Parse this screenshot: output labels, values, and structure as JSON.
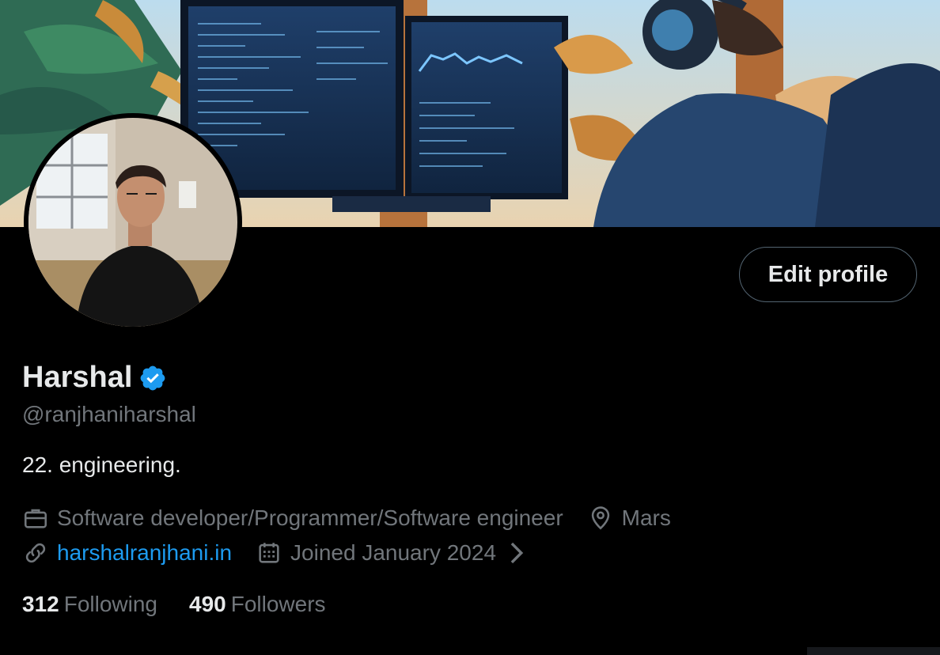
{
  "profile": {
    "name": "Harshal",
    "handle": "@ranjhaniharshal",
    "bio": "22. engineering.",
    "profession": "Software developer/Programmer/Software engineer",
    "location": "Mars",
    "website": "harshalranjhani.in",
    "joined": "Joined January 2024",
    "edit_label": "Edit profile",
    "verified": true
  },
  "stats": {
    "following_count": "312",
    "following_label": "Following",
    "followers_count": "490",
    "followers_label": "Followers"
  },
  "icons": {
    "profession": "briefcase-icon",
    "location": "location-pin-icon",
    "website": "link-icon",
    "joined": "calendar-icon",
    "verified": "verified-badge-icon",
    "chevron": "chevron-right-icon"
  },
  "colors": {
    "background": "#000000",
    "primary_text": "#e7e9ea",
    "secondary_text": "#71767b",
    "accent": "#1d9bf0",
    "button_border": "#536471"
  }
}
